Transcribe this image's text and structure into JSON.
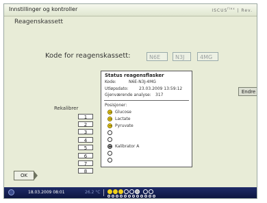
{
  "window": {
    "title": "Innstillinger og kontroller",
    "brand": "ISCUS",
    "brand_sup": "flex",
    "brand_suffix": "| Rev."
  },
  "section_title": "Reagenskassett",
  "kit_code": {
    "label": "Kode for reagenskassett:",
    "segments": [
      "N6E",
      "N3J",
      "4MG"
    ]
  },
  "status_panel": {
    "title": "Status reagensflasker",
    "code_label": "Kode:",
    "code_value": "N6E-N3J-4MG",
    "expiry_label": "Utløpsdato:",
    "expiry_value": "23.03.2009 13:59:12",
    "remaining_label": "Gjenværende analyse:",
    "remaining_value": "317",
    "positions_label": "Posisjoner:",
    "positions": [
      {
        "name": "Glucose",
        "state": "yellow"
      },
      {
        "name": "Lactate",
        "state": "yellow"
      },
      {
        "name": "Pyruvate",
        "state": "yellow"
      },
      {
        "name": "",
        "state": "empty"
      },
      {
        "name": "",
        "state": "empty"
      },
      {
        "name": "Kalibrator A",
        "state": "grey"
      },
      {
        "name": "",
        "state": "empty"
      },
      {
        "name": "",
        "state": "empty"
      }
    ]
  },
  "edit_button": "Endre",
  "recalibrate": {
    "label": "Rekalibrer",
    "buttons": [
      "1",
      "2",
      "3",
      "4",
      "5",
      "6",
      "7",
      "8"
    ]
  },
  "ok_button": "OK",
  "statusbar": {
    "datetime": "18.03.2009 08:01",
    "temperature": "26.2 °C"
  },
  "colors": {
    "background": "#e8ecd7",
    "statusbar": "#1e2a66",
    "reagent_yellow": "#f4d21a",
    "calibrator_grey": "#8e8e8e"
  }
}
